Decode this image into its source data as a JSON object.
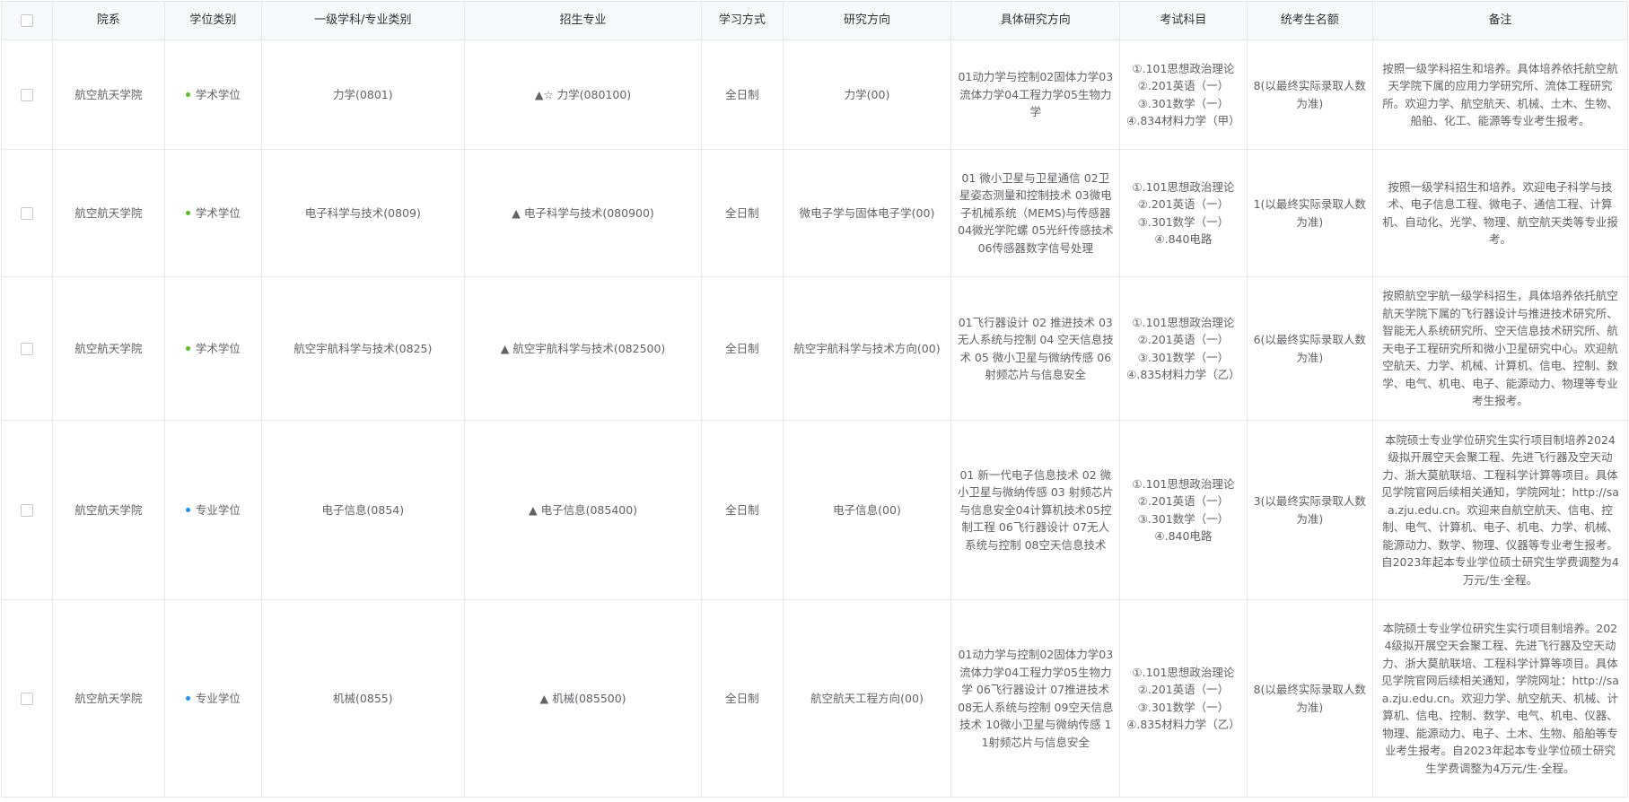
{
  "headers": [
    "院系",
    "学位类别",
    "一级学科/专业类别",
    "招生专业",
    "学习方式",
    "研究方向",
    "具体研究方向",
    "考试科目",
    "统考生名额",
    "备注"
  ],
  "colors": {
    "academic_dot": "#52c41a",
    "professional_dot": "#1890ff"
  },
  "rows": [
    {
      "dept": "航空航天学院",
      "degree_type": "学术学位",
      "degree_kind": "academic",
      "discipline": "力学(0801)",
      "major": "▲☆ 力学(080100)",
      "mode": "全日制",
      "direction": "力学(00)",
      "specific": "01动力学与控制02固体力学03流体力学04工程力学05生物力学",
      "exams": [
        "①.101思想政治理论",
        "②.201英语（一）",
        "③.301数学（一）",
        "④.834材料力学（甲）"
      ],
      "quota": "8(以最终实际录取人数为准)",
      "note": "按照一级学科招生和培养。具体培养依托航空航天学院下属的应用力学研究所、流体工程研究所。欢迎力学、航空航天、机械、土木、生物、船舶、化工、能源等专业考生报考。"
    },
    {
      "dept": "航空航天学院",
      "degree_type": "学术学位",
      "degree_kind": "academic",
      "discipline": "电子科学与技术(0809)",
      "major": "▲ 电子科学与技术(080900)",
      "mode": "全日制",
      "direction": "微电子学与固体电子学(00)",
      "specific": "01 微小卫星与卫星通信 02卫星姿态测量和控制技术 03微电子机械系统（MEMS)与传感器 04微光学陀螺 05光纤传感技术06传感器数字信号处理",
      "exams": [
        "①.101思想政治理论",
        "②.201英语（一）",
        "③.301数学（一）",
        "④.840电路"
      ],
      "quota": "1(以最终实际录取人数为准)",
      "note": "按照一级学科招生和培养。欢迎电子科学与技术、电子信息工程、微电子、通信工程、计算机、自动化、光学、物理、航空航天类等专业报考。"
    },
    {
      "dept": "航空航天学院",
      "degree_type": "学术学位",
      "degree_kind": "academic",
      "discipline": "航空宇航科学与技术(0825)",
      "major": "▲ 航空宇航科学与技术(082500)",
      "mode": "全日制",
      "direction": "航空宇航科学与技术方向(00)",
      "specific": "01飞行器设计 02 推进技术 03无人系统与控制 04 空天信息技术 05 微小卫星与微纳传感 06 射频芯片与信息安全",
      "exams": [
        "①.101思想政治理论",
        "②.201英语（一）",
        "③.301数学（一）",
        "④.835材料力学（乙）"
      ],
      "quota": "6(以最终实际录取人数为准)",
      "note": "按照航空宇航一级学科招生，具体培养依托航空航天学院下属的飞行器设计与推进技术研究所、智能无人系统研究所、空天信息技术研究所、航天电子工程研究所和微小卫星研究中心。欢迎航空航天、力学、机械、计算机、信电、控制、数学、电气、机电、电子、能源动力、物理等专业考生报考。"
    },
    {
      "dept": "航空航天学院",
      "degree_type": "专业学位",
      "degree_kind": "professional",
      "discipline": "电子信息(0854)",
      "major": "▲ 电子信息(085400)",
      "mode": "全日制",
      "direction": "电子信息(00)",
      "specific": "01 新一代电子信息技术 02 微小卫星与微纳传感 03 射频芯片与信息安全04计算机技术05控制工程 06飞行器设计 07无人系统与控制 08空天信息技术",
      "exams": [
        "①.101思想政治理论",
        "②.201英语（一）",
        "③.301数学（一）",
        "④.840电路"
      ],
      "quota": "3(以最终实际录取人数为准)",
      "note": "本院硕士专业学位研究生实行项目制培养2024级拟开展空天会聚工程、先进飞行器及空天动力、浙大莫航联培、工程科学计算等项目。具体见学院官网后续相关通知，学院网址：http://saa.zju.edu.cn。欢迎来自航空航天、信电、控制、电气、计算机、电子、机电、力学、机械、能源动力、数学、物理、仪器等专业考生报考。 自2023年起本专业学位硕士研究生学费调整为4万元/生·全程。"
    },
    {
      "dept": "航空航天学院",
      "degree_type": "专业学位",
      "degree_kind": "professional",
      "discipline": "机械(0855)",
      "major": "▲ 机械(085500)",
      "mode": "全日制",
      "direction": "航空航天工程方向(00)",
      "specific": "01动力学与控制02固体力学03流体力学04工程力学05生物力学 06飞行器设计 07推进技术 08无人系统与控制 09空天信息技术 10微小卫星与微纳传感 11射频芯片与信息安全",
      "exams": [
        "①.101思想政治理论",
        "②.201英语（一）",
        "③.301数学（一）",
        "④.835材料力学（乙）"
      ],
      "quota": "8(以最终实际录取人数为准)",
      "note": "本院硕士专业学位研究生实行项目制培养。2024级拟开展空天会聚工程、先进飞行器及空天动力、浙大莫航联培、工程科学计算等项目。具体见学院官网后续相关通知，学院网址：http://saa.zju.edu.cn。欢迎力学、航空航天、机械、计算机、信电、控制、数学、电气、机电、仪器、物理、能源动力、电子、土木、生物、船舶等专业考生报考。自2023年起本专业学位硕士研究生学费调整为4万元/生·全程。"
    }
  ]
}
